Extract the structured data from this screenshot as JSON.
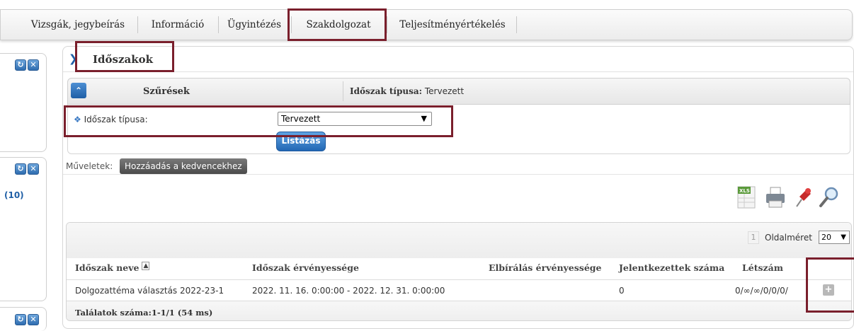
{
  "menu": {
    "items": [
      "Vizsgák, jegybeírás",
      "Információ",
      "Ügyintézés",
      "Szakdolgozat",
      "Teljesítményértékelés"
    ]
  },
  "left": {
    "count_label": "(10)"
  },
  "page": {
    "title": "Időszakok"
  },
  "filter": {
    "header": "Szűrések",
    "summary_label": "Időszak típusa:",
    "summary_value": "Tervezett",
    "field_label": "Időszak típusa:",
    "field_value": "Tervezett",
    "list_button": "Listázás"
  },
  "operations": {
    "label": "Műveletek:",
    "favorite_button": "Hozzáadás a kedvencekhez"
  },
  "toolbar": {
    "icons": [
      "excel-export-icon",
      "print-icon",
      "pin-icon",
      "search-icon"
    ]
  },
  "grid": {
    "page_number": "1",
    "page_size_label": "Oldalméret",
    "page_size_value": "20",
    "columns": [
      "Időszak neve",
      "Időszak érvényessége",
      "Elbírálás érvényessége",
      "Jelentkezettek száma",
      "Létszám"
    ],
    "rows": [
      {
        "name": "Dolgozattéma választás 2022-23-1",
        "validity": "2022. 11. 16. 0:00:00 - 2022. 12. 31. 0:00:00",
        "review_validity": "",
        "applicants": "0",
        "headcount": "0/∞/∞/0/0/0/"
      }
    ],
    "results": "Találatok száma:1-1/1 (54 ms)"
  },
  "colors": {
    "highlight": "#7a1f2c",
    "accent_blue": "#1f5fa6"
  }
}
